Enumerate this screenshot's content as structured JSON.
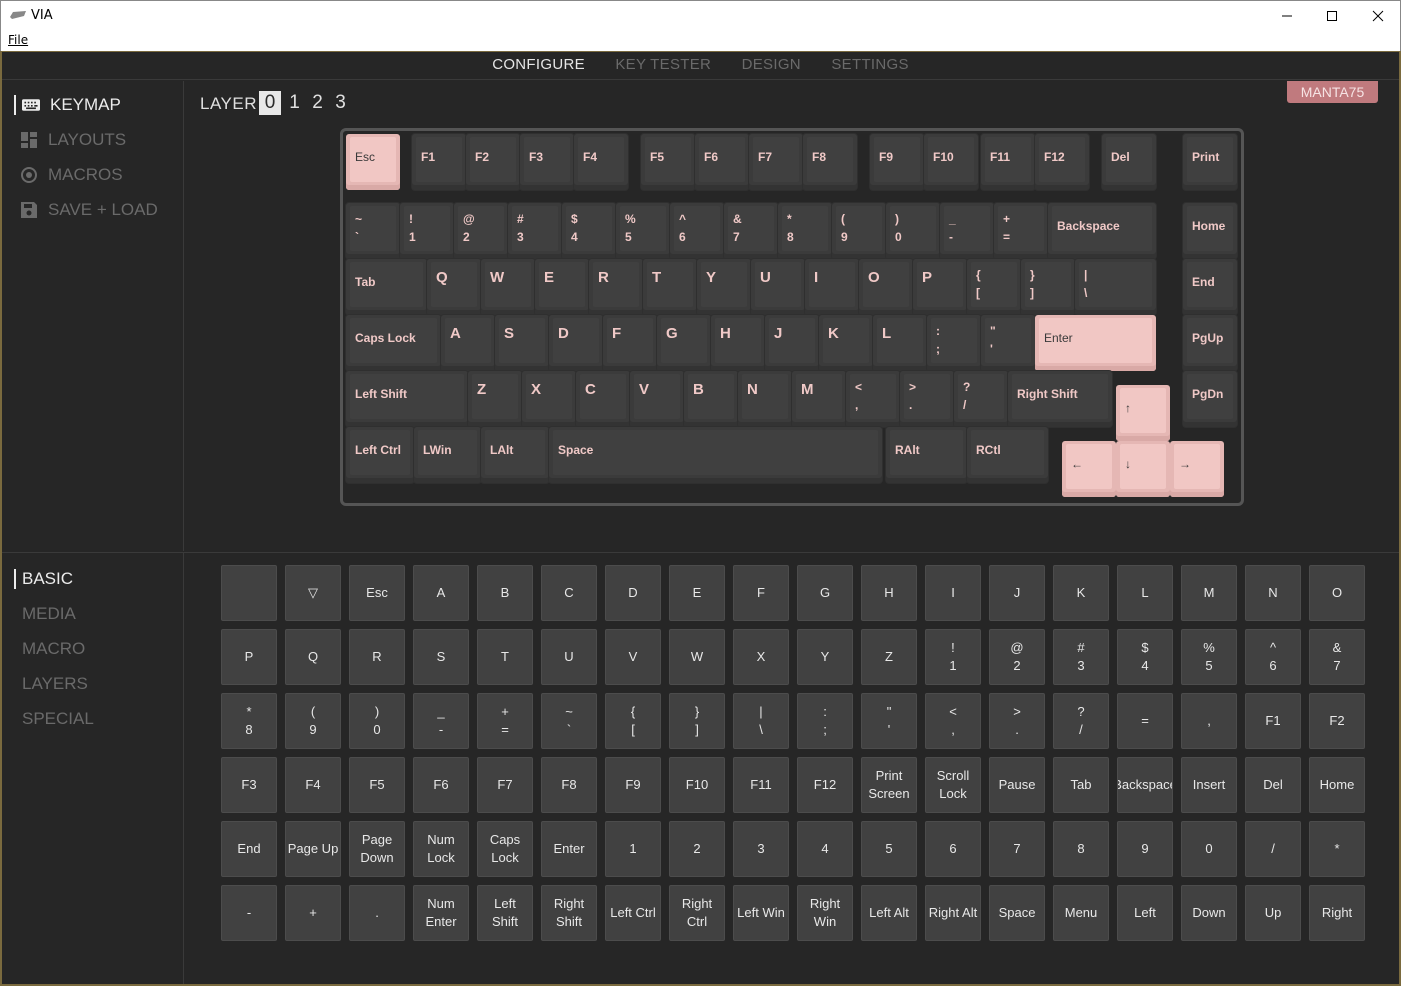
{
  "window": {
    "title": "VIA",
    "menu_file": "File"
  },
  "topnav": [
    "CONFIGURE",
    "KEY TESTER",
    "DESIGN",
    "SETTINGS"
  ],
  "left_menu": [
    {
      "label": "KEYMAP",
      "icon": "keyboard-icon"
    },
    {
      "label": "LAYOUTS",
      "icon": "layouts-icon"
    },
    {
      "label": "MACROS",
      "icon": "macros-icon"
    },
    {
      "label": "SAVE + LOAD",
      "icon": "save-icon"
    }
  ],
  "key_menu": [
    "BASIC",
    "MEDIA",
    "MACRO",
    "LAYERS",
    "SPECIAL"
  ],
  "layer": {
    "label": "LAYER",
    "options": [
      "0",
      "1",
      "2",
      "3"
    ],
    "selected": "0"
  },
  "device_badge": "MANTA75",
  "keyboard": {
    "row0": [
      "Esc",
      "F1",
      "F2",
      "F3",
      "F4",
      "F5",
      "F6",
      "F7",
      "F8",
      "F9",
      "F10",
      "F11",
      "F12",
      "Del",
      "Print"
    ],
    "row1": [
      [
        "~",
        "`"
      ],
      [
        "!",
        "1"
      ],
      [
        "@",
        "2"
      ],
      [
        "#",
        "3"
      ],
      [
        "$",
        "4"
      ],
      [
        "%",
        "5"
      ],
      [
        "^",
        "6"
      ],
      [
        "&",
        "7"
      ],
      [
        "*",
        "8"
      ],
      [
        "(",
        "9"
      ],
      [
        ")",
        "0"
      ],
      [
        "_",
        "-"
      ],
      [
        "+",
        "="
      ],
      "Backspace",
      "Home"
    ],
    "row2": [
      "Tab",
      "Q",
      "W",
      "E",
      "R",
      "T",
      "Y",
      "U",
      "I",
      "O",
      "P",
      [
        "{",
        "["
      ],
      [
        "}",
        "]"
      ],
      [
        "|",
        "\\"
      ],
      "End"
    ],
    "row3": [
      "Caps Lock",
      "A",
      "S",
      "D",
      "F",
      "G",
      "H",
      "J",
      "K",
      "L",
      [
        ":",
        ";"
      ],
      [
        "\"",
        "'"
      ],
      "Enter",
      "PgUp"
    ],
    "row4": [
      "Left Shift",
      "Z",
      "X",
      "C",
      "V",
      "B",
      "N",
      "M",
      [
        "<",
        ","
      ],
      [
        ">",
        "."
      ],
      [
        "?",
        "/"
      ],
      "Right Shift",
      "↑",
      "PgDn"
    ],
    "row5": [
      "Left Ctrl",
      "LWin",
      "LAlt",
      "Space",
      "RAlt",
      "RCtl",
      "←",
      "↓",
      "→"
    ]
  },
  "basic_keys": [
    "",
    "▽",
    "Esc",
    "A",
    "B",
    "C",
    "D",
    "E",
    "F",
    "G",
    "H",
    "I",
    "J",
    "K",
    "L",
    "M",
    "N",
    "O",
    "P",
    "Q",
    "R",
    "S",
    "T",
    "U",
    "V",
    "W",
    "X",
    "Y",
    "Z",
    "!\n1",
    "@\n2",
    "#\n3",
    "$\n4",
    "%\n5",
    "^\n6",
    "&\n7",
    "*\n8",
    "(\n9",
    ")\n0",
    "_\n-",
    "+\n=",
    "~\n`",
    "{\n[",
    "}\n]",
    "|\n\\",
    ":\n;",
    "\"\n'",
    "<\n,",
    ">\n.",
    "?\n/",
    "=",
    ",",
    "F1",
    "F2",
    "F3",
    "F4",
    "F5",
    "F6",
    "F7",
    "F8",
    "F9",
    "F10",
    "F11",
    "F12",
    "Print\nScreen",
    "Scroll\nLock",
    "Pause",
    "Tab",
    "Backspace",
    "Insert",
    "Del",
    "Home",
    "End",
    "Page Up",
    "Page\nDown",
    "Num\nLock",
    "Caps\nLock",
    "Enter",
    "1",
    "2",
    "3",
    "4",
    "5",
    "6",
    "7",
    "8",
    "9",
    "0",
    "/",
    "*",
    "-",
    "+",
    ".",
    "Num\nEnter",
    "Left\nShift",
    "Right\nShift",
    "Left Ctrl",
    "Right\nCtrl",
    "Left Win",
    "Right\nWin",
    "Left Alt",
    "Right Alt",
    "Space",
    "Menu",
    "Left",
    "Down",
    "Up",
    "Right"
  ],
  "colors": {
    "accent": "#f1c7c4",
    "badge": "#c07a7e",
    "background": "#262626"
  }
}
